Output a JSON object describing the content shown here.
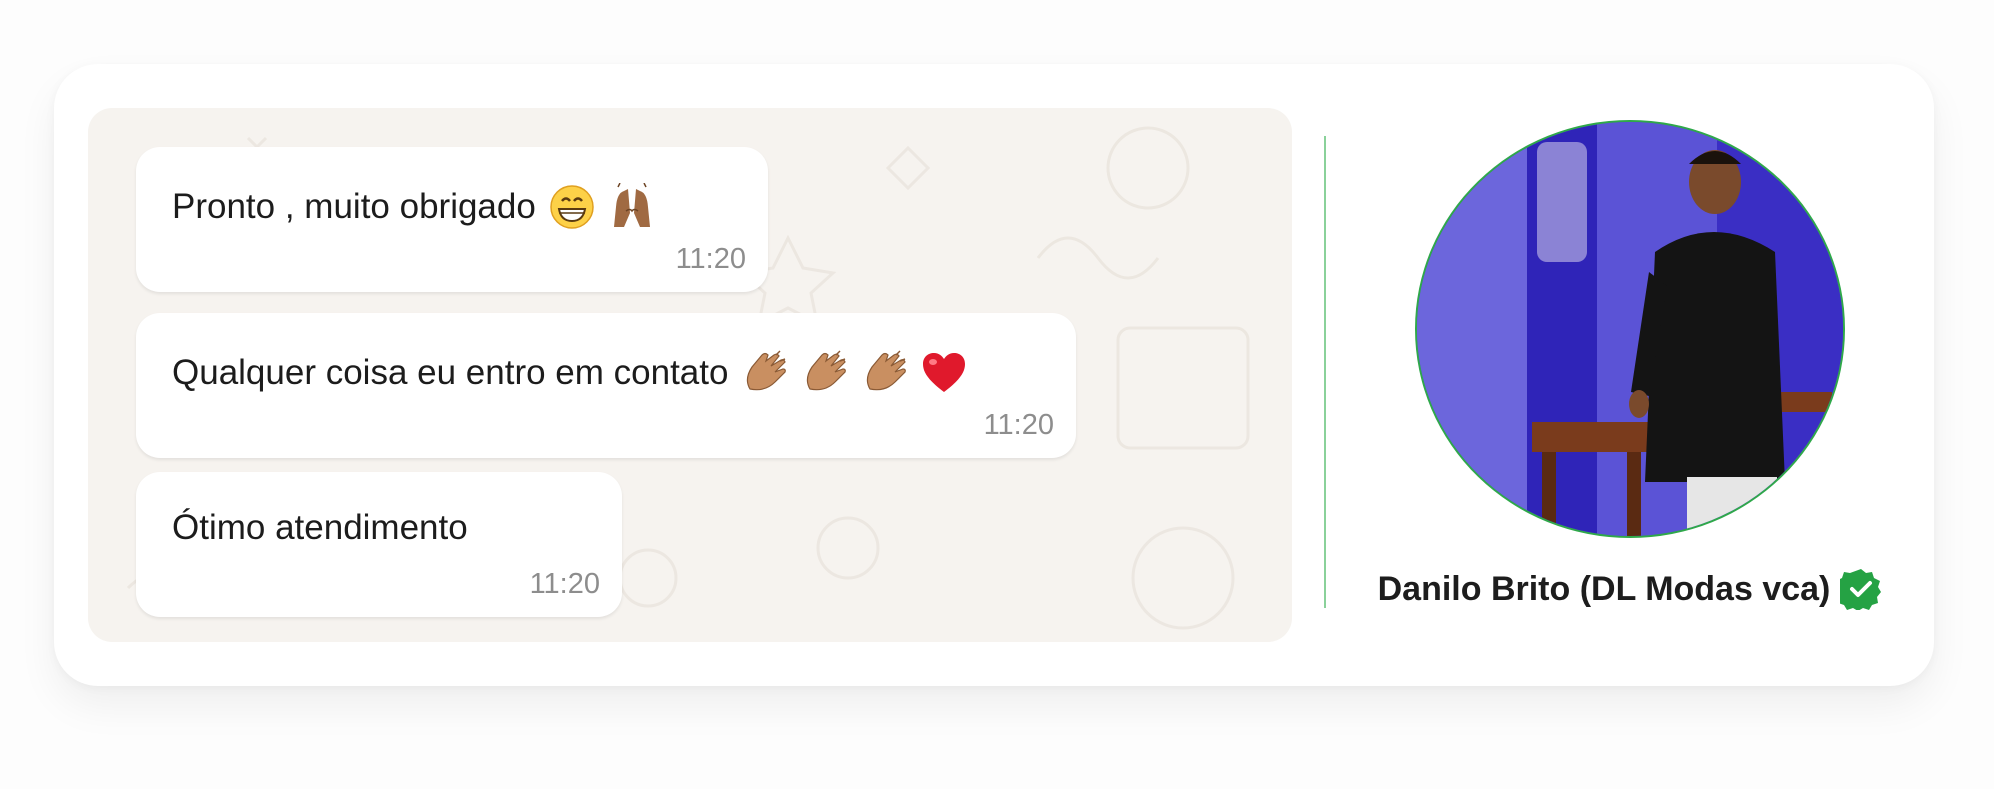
{
  "messages": [
    {
      "text": "Pronto , muito obrigado",
      "emojis": [
        "grinning-face-icon",
        "raising-hands-icon"
      ],
      "time": "11:20"
    },
    {
      "text": "Qualquer coisa eu entro em contato",
      "emojis": [
        "clapping-hands-icon",
        "clapping-hands-icon",
        "clapping-hands-icon",
        "red-heart-icon"
      ],
      "time": "11:20"
    },
    {
      "text": "Ótimo atendimento",
      "emojis": [],
      "time": "11:20"
    }
  ],
  "contact": {
    "name": "Danilo Brito (DL Modas vca)",
    "verified_icon": "verified-badge-icon",
    "avatar_icon": "profile-photo"
  },
  "colors": {
    "chat_background": "#f6f3ef",
    "bubble": "#ffffff",
    "accent_green": "#25a244",
    "divider_green": "#8ad19a"
  }
}
